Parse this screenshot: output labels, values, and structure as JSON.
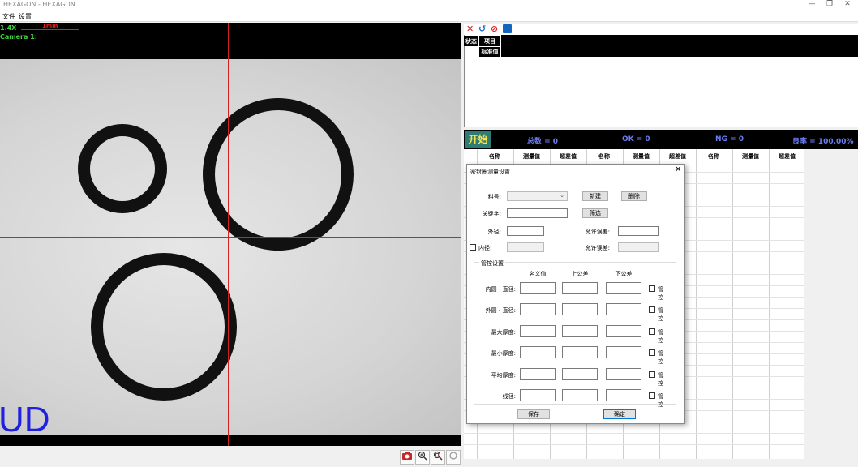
{
  "window": {
    "title": "HEXAGON - HEXAGON",
    "minimize": "—",
    "restore": "❐",
    "close": "✕"
  },
  "menu": {
    "file": "文件",
    "settings": "设置"
  },
  "camera": {
    "zoom": "1.4X",
    "name": "Camera 1:",
    "scale_label": "1mm",
    "overlay_text": "UD"
  },
  "top_table": {
    "status": "状态",
    "item": "项目",
    "standard": "标准值"
  },
  "stats": {
    "start": "开始",
    "total": "总数 = 0",
    "ok": "OK = 0",
    "ng": "NG = 0",
    "yield": "良率 = 100.00%"
  },
  "results_headers": [
    "名称",
    "测量值",
    "超差值",
    "名称",
    "测量值",
    "超差值",
    "名称",
    "测量值",
    "超差值"
  ],
  "dialog": {
    "title": "密封圈测量设置",
    "close": "✕",
    "material_label": "料号:",
    "material_value": "",
    "new_btn": "新建",
    "delete_btn": "删除",
    "keyword_label": "关键字:",
    "keyword_value": "",
    "filter_btn": "筛选",
    "outer_label": "外径:",
    "outer_value": "",
    "tolerance_label_1": "允许误差:",
    "tolerance_value_1": "",
    "inner_label": "内径:",
    "inner_value": "",
    "tolerance_label_2": "允许误差:",
    "tolerance_value_2": "",
    "group_title": "管控设置",
    "col_nominal": "名义值",
    "col_upper": "上公差",
    "col_lower": "下公差",
    "rows": [
      {
        "label": "内圆 - 直径:",
        "nominal": "",
        "upper": "",
        "lower": "",
        "ctrl": "管控"
      },
      {
        "label": "外圆 - 直径:",
        "nominal": "",
        "upper": "",
        "lower": "",
        "ctrl": "管控"
      },
      {
        "label": "最大厚度:",
        "nominal": "",
        "upper": "",
        "lower": "",
        "ctrl": "管控"
      },
      {
        "label": "最小厚度:",
        "nominal": "",
        "upper": "",
        "lower": "",
        "ctrl": "管控"
      },
      {
        "label": "平均厚度:",
        "nominal": "",
        "upper": "",
        "lower": "",
        "ctrl": "管控"
      },
      {
        "label": "线径:",
        "nominal": "",
        "upper": "",
        "lower": "",
        "ctrl": "管控"
      }
    ],
    "save_btn": "保存",
    "ok_btn": "确定"
  },
  "colors": {
    "accent": "#2e7d74",
    "stat_text": "#6a7cf0",
    "crosshair": "#d82020",
    "overlay": "#2020e0"
  }
}
